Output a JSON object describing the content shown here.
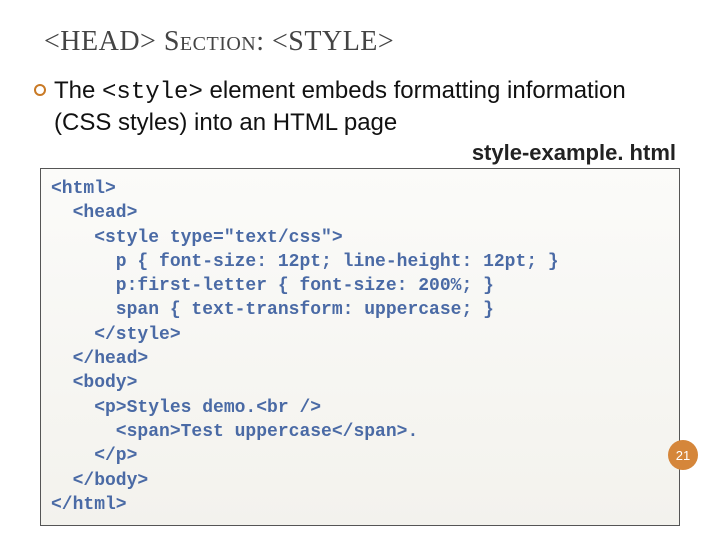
{
  "title_html": "&lt;HEAD&gt; Section: &lt;STYLE&gt;",
  "bullet": {
    "pre": "The ",
    "code": "<style>",
    "post": " element embeds formatting information (CSS styles) into an HTML page"
  },
  "filename": "style-example. html",
  "code_lines": [
    "<html>",
    "  <head>",
    "    <style type=\"text/css\">",
    "      p { font-size: 12pt; line-height: 12pt; }",
    "      p:first-letter { font-size: 200%; }",
    "      span { text-transform: uppercase; }",
    "    </style>",
    "  </head>",
    "  <body>",
    "    <p>Styles demo.<br />",
    "      <span>Test uppercase</span>.",
    "    </p>",
    "  </body>",
    "</html>"
  ],
  "page_number": "21"
}
